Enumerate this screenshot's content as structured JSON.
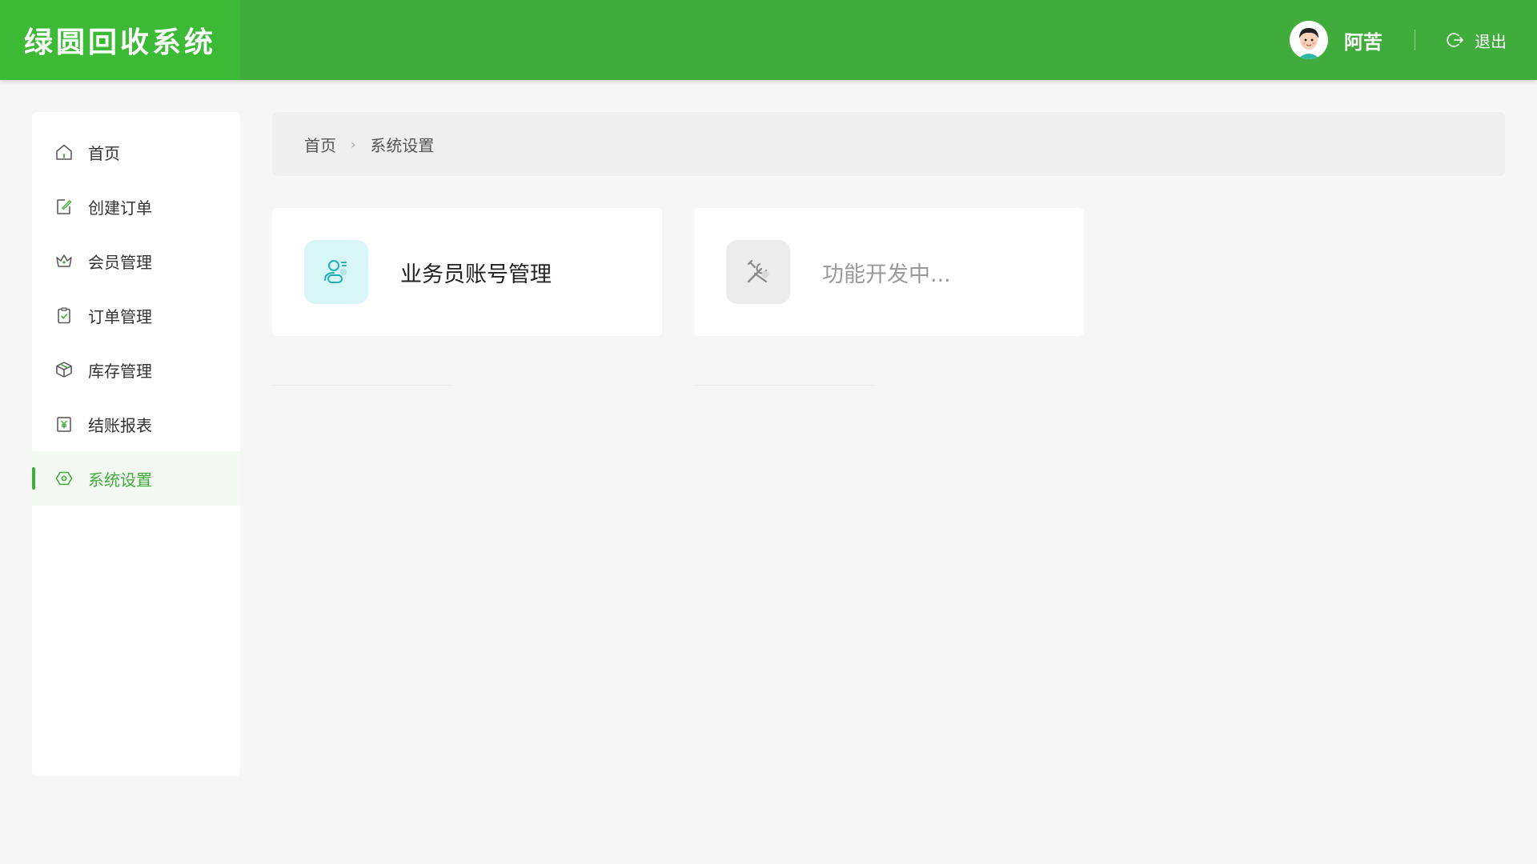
{
  "app": {
    "title": "绿圆回收系统"
  },
  "user": {
    "name": "阿苦",
    "logout_label": "退出"
  },
  "sidebar": {
    "items": [
      {
        "label": "首页",
        "icon": "home-icon"
      },
      {
        "label": "创建订单",
        "icon": "edit-order-icon"
      },
      {
        "label": "会员管理",
        "icon": "crown-icon"
      },
      {
        "label": "订单管理",
        "icon": "clipboard-check-icon"
      },
      {
        "label": "库存管理",
        "icon": "box-icon"
      },
      {
        "label": "结账报表",
        "icon": "yen-report-icon"
      },
      {
        "label": "系统设置",
        "icon": "settings-icon",
        "active": true
      }
    ]
  },
  "breadcrumb": {
    "home": "首页",
    "current": "系统设置"
  },
  "cards": [
    {
      "label": "业务员账号管理",
      "icon": "user-account-icon"
    },
    {
      "label": "功能开发中...",
      "icon": "tools-icon"
    }
  ],
  "colors": {
    "brand": "#3fac3c",
    "logo_bg": "#3cba35",
    "active_bg": "#f4faf3",
    "card1_icon_bg": "#d9f6f7",
    "card2_icon_bg": "#ececec"
  }
}
